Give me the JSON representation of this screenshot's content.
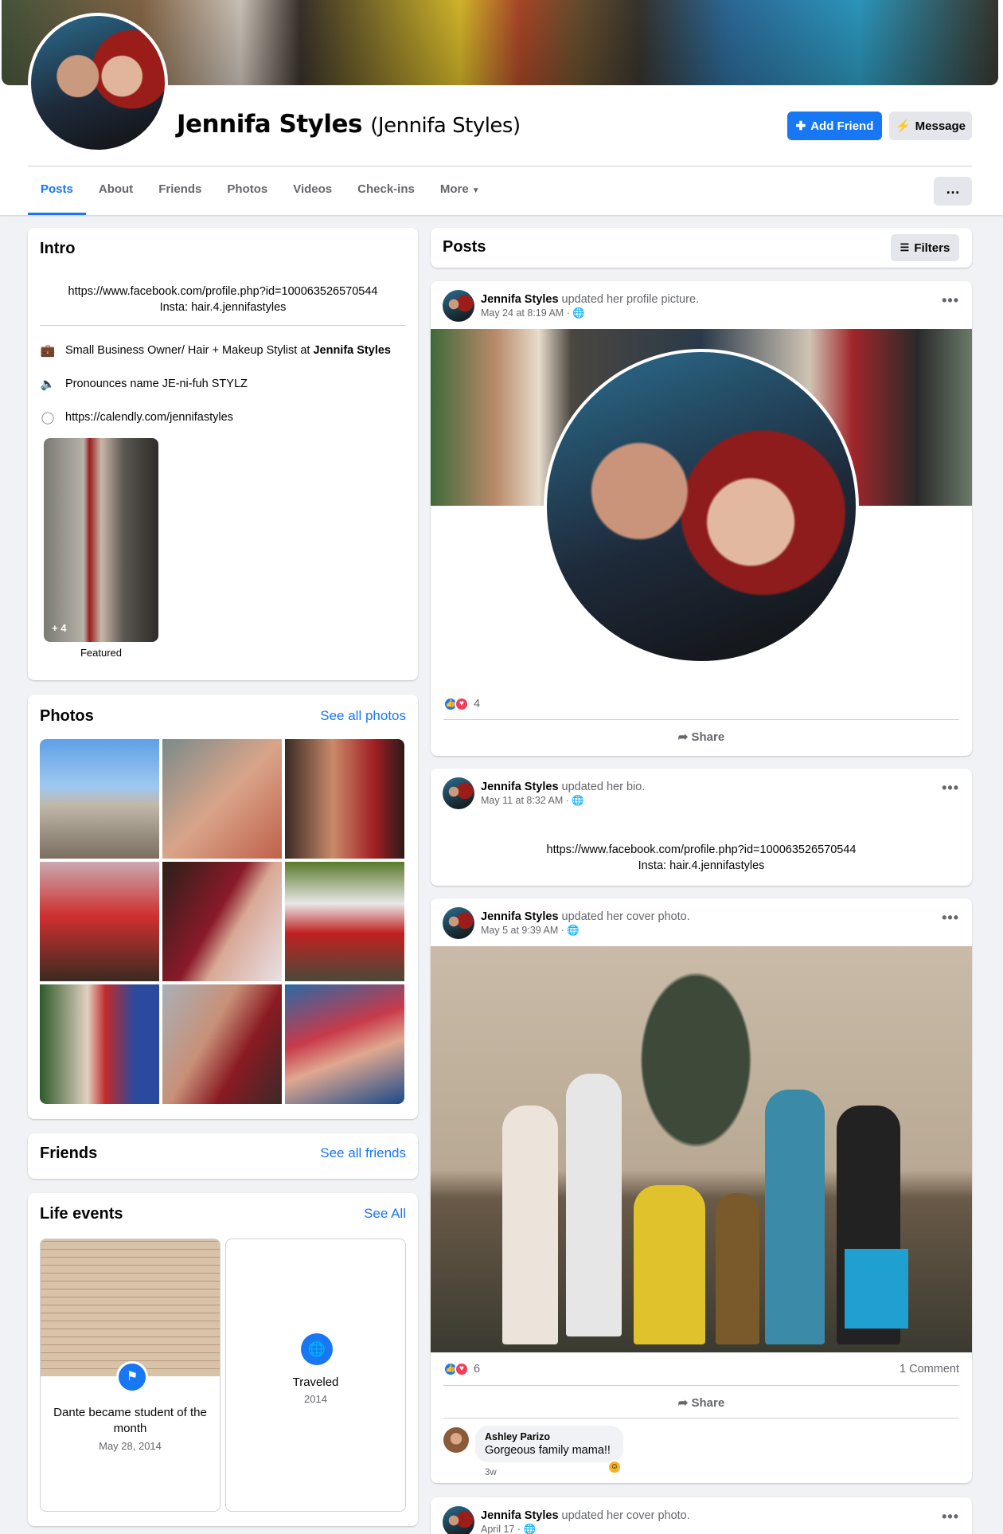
{
  "profile": {
    "name": "Jennifa Styles",
    "alt_name": "(Jennifa Styles)",
    "add_friend_label": "Add Friend",
    "message_label": "Message"
  },
  "tabs": [
    {
      "label": "Posts",
      "active": true
    },
    {
      "label": "About"
    },
    {
      "label": "Friends"
    },
    {
      "label": "Photos"
    },
    {
      "label": "Videos"
    },
    {
      "label": "Check-ins"
    },
    {
      "label": "More"
    }
  ],
  "more_menu_icon": "…",
  "intro": {
    "title": "Intro",
    "bio_line1": "https://www.facebook.com/profile.php?id=100063526570544",
    "bio_line2": "Insta: hair.4.jennifastyles",
    "work_prefix": "Small Business Owner/ Hair + Makeup Stylist at ",
    "work_place": "Jennifa Styles",
    "pronounce": "Pronounces name JE-ni-fuh STYLZ",
    "website": "https://calendly.com/jennifastyles",
    "featured_count": "+ 4",
    "featured_label": "Featured"
  },
  "photos": {
    "title": "Photos",
    "see_all": "See all photos",
    "thumbs": [
      {
        "name": "castle-photo",
        "bg": "linear-gradient(180deg,#5fa0e8 0%,#9fc8f0 40%,#c0b8a8 55%,#7a6e60 100%)"
      },
      {
        "name": "girl-cart-photo",
        "bg": "linear-gradient(135deg,#7a8a8a,#d9a58a 50%,#c0604a)"
      },
      {
        "name": "selfie-photo",
        "bg": "linear-gradient(90deg,#3a2a24,#c98a6a 40%,#a01e22 75%,#2a1a18)"
      },
      {
        "name": "girl-dog-photo",
        "bg": "linear-gradient(180deg,#c9a9b0,#d03030 45%,#3a2a20 100%)"
      },
      {
        "name": "red-hair-photo",
        "bg": "linear-gradient(120deg,#2a2018,#8a1a2a 45%,#d9a896 60%,#e8e0e4)"
      },
      {
        "name": "santa-photo",
        "bg": "linear-gradient(180deg,#5a7a2a,#e8e8e8 35%,#c02020 60%,#4a4a3a)"
      },
      {
        "name": "tree-photo",
        "bg": "linear-gradient(90deg,#2e5a2a,#e0d0c0 40%,#c02a2a 55%,#2a4aa0 80%)"
      },
      {
        "name": "mom-daughter-photo",
        "bg": "linear-gradient(120deg,#a8b0b8,#c89078 40%,#8a1a22 65%,#3a2a28)"
      },
      {
        "name": "glasses-selfie-photo",
        "bg": "linear-gradient(160deg,#2a6aa8,#c83a4a 40%,#e0a890 60%,#1a4a88)"
      }
    ]
  },
  "friends": {
    "title": "Friends",
    "see_all": "See all friends"
  },
  "life_events": {
    "title": "Life events",
    "see_all": "See All",
    "event1_title": "Dante became student of the month",
    "event1_date": "May 28, 2014",
    "event2_title": "Traveled",
    "event2_date": "2014"
  },
  "posts_header": {
    "title": "Posts",
    "filters_label": "Filters"
  },
  "posts": [
    {
      "author": "Jennifa Styles",
      "action": " updated her profile picture.",
      "time": "May 24 at 8:19 AM · ",
      "reactions": "4",
      "share": "Share"
    },
    {
      "author": "Jennifa Styles",
      "action": " updated her bio.",
      "time": "May 11 at 8:32 AM · ",
      "bio_line1": "https://www.facebook.com/profile.php?id=100063526570544",
      "bio_line2": "Insta: hair.4.jennifastyles"
    },
    {
      "author": "Jennifa Styles",
      "action": " updated her cover photo.",
      "time": "May 5 at 9:39 AM · ",
      "reactions": "6",
      "comments": "1 Comment",
      "share": "Share",
      "comment_author": "Ashley Parizo",
      "comment_text": "Gorgeous family mama!!",
      "comment_time": "3w"
    },
    {
      "author": "Jennifa Styles",
      "action": " updated her cover photo.",
      "time": "April 17 · "
    }
  ],
  "colors": {
    "accent": "#1877f2",
    "bg": "#f0f2f5",
    "love": "#f33e58"
  }
}
